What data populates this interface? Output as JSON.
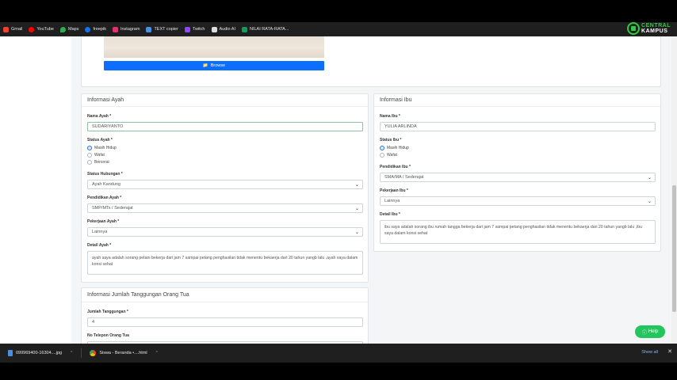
{
  "bookmarks": [
    {
      "label": "Gmail",
      "color": "#ea4335"
    },
    {
      "label": "YouTube",
      "color": "#ff0000"
    },
    {
      "label": "Maps",
      "color": "#34a853"
    },
    {
      "label": "freepik",
      "color": "#1273eb"
    },
    {
      "label": "Instagram",
      "color": "#e1306c"
    },
    {
      "label": "TEXT copier",
      "color": "#4a90e2"
    },
    {
      "label": "Twitch",
      "color": "#9146ff"
    },
    {
      "label": "Audio AI",
      "color": "#dddddd"
    },
    {
      "label": "NILAI RATA-RATA...",
      "color": "#0f9d58"
    }
  ],
  "logo": {
    "line1": "CENTRAL",
    "line2": "KAMPUS"
  },
  "upload": {
    "browse_label": "Browse"
  },
  "ayah": {
    "title": "Informasi Ayah",
    "nama_label": "Nama Ayah *",
    "nama_value": "SUDARIYANTO",
    "status_label": "Status Ayah *",
    "status_options": [
      "Masih Hidup",
      "Wafat",
      "Bercerai"
    ],
    "hubungan_label": "Status Hubungan *",
    "hubungan_value": "Ayah Kandung",
    "pendidikan_label": "Pendidikan Ayah *",
    "pendidikan_value": "SMP/MTs / Sederajat",
    "pekerjaan_label": "Pekerjaan Ayah *",
    "pekerjaan_value": "Lainnya",
    "detail_label": "Detail Ayah *",
    "detail_value": "ayah saya adalah sorang petani bekerja dari jam 7 sampai petang penghasilan tidak menentu bekaerja dari 20 tahun yangb lalu ,ayah saya dalam konsi sehat"
  },
  "ibu": {
    "title": "Informasi Ibu",
    "nama_label": "Nama Ibu *",
    "nama_value": "YULIA ARLINDA",
    "status_label": "Status Ibu *",
    "status_options": [
      "Masih Hidup",
      "Wafat"
    ],
    "pendidikan_label": "Pendidikan Ibu *",
    "pendidikan_value": "SMA/MA / Sederajat",
    "pekerjaan_label": "Pekerjaan Ibu *",
    "pekerjaan_value": "Lainnya",
    "detail_label": "Detail Ibu *",
    "detail_value": "ibu saya adalah sorang ibu rumah tangga bekerja dari jam 7 sampai petang penghasilan tidak menentu bekaerja dari 20 tahun yangb lalu ,ibu saya dalam konsi sehat"
  },
  "tanggungan": {
    "title": "Informasi Jumlah Tanggungan Orang Tua",
    "jumlah_label": "Jumlah Tanggungan *",
    "jumlah_value": "4",
    "telepon_label": "No Telepon Orang Tua"
  },
  "help_label": "Help",
  "downloads": [
    {
      "name": "099969400-16304....jpg"
    },
    {
      "name": "Siswa - Beranda •....html"
    }
  ],
  "show_all": "Show all",
  "close_glyph": "✕"
}
